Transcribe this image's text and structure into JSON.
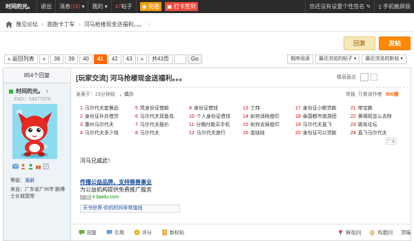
{
  "topbar": {
    "username": "时间的光。",
    "logout": "退出",
    "messages_label": "消息",
    "messages_count": "(16)",
    "mine_label": "我的",
    "coins_count": "47",
    "coins_label": "帖子",
    "recharge": "充值",
    "checkin": "打卡签到",
    "signature_prompt": "您还没有设置个性签名",
    "mobile": "手机触屏版"
  },
  "breadcrumb": {
    "items": [
      "豫见论坛",
      "跑跑卡丁车",
      "河马抢楼现金送福利。。。"
    ]
  },
  "actions_top": {
    "reply": "回复",
    "post": "发帖"
  },
  "pager": {
    "back": "« 返回列表",
    "first": "«",
    "pages": [
      "38",
      "39",
      "40",
      "41",
      "42",
      "43"
    ],
    "current": "41",
    "next": "»",
    "total": "共43页",
    "go": "Go"
  },
  "sortbar": {
    "items": [
      "倒序阅读",
      "最近浏览的帖子 ▾",
      "最近浏览的新帖 ▾"
    ]
  },
  "sidebar": {
    "reply_count": "854个回复",
    "username": "时间的光。",
    "uid": "ZxID：53477079",
    "level_label": "等级：",
    "level_value": "准尉",
    "from_label": "来自：广东省广州市 鹏博士长城宽带"
  },
  "post": {
    "tag": "[玩家交流]",
    "title": "河马抢楼现金送福利。。。",
    "subscribe_label": "楼层直达",
    "posted_time": "发表于：23分钟前",
    "author_link": "，偶尔",
    "report": "举报",
    "only_author": "只看该作者",
    "floor": "800楼",
    "content": "河马兄威武！",
    "banner_ad": {
      "line1": "传播公益品牌，支持慈善事业",
      "line2": "为公益机构提供免费推广服务",
      "domain_tag": "广告",
      "domain": "e.baidu.com"
    },
    "signature": "天书世界-你的时间非常值钱"
  },
  "ad_columns": [
    [
      {
        "n": "1",
        "t": "马尔代夫套餐品"
      },
      {
        "n": "2",
        "t": "身份证补办借贷"
      },
      {
        "n": "3",
        "t": "惠州马尔代夫"
      },
      {
        "n": "4",
        "t": "马尔代夫多少钱"
      }
    ],
    [
      {
        "n": "5",
        "t": "凭身份证借款"
      },
      {
        "n": "6",
        "t": "马尔代夫双鱼岛"
      },
      {
        "n": "7",
        "t": "马尔代夫报价"
      },
      {
        "n": "8",
        "t": "马尔代夫"
      }
    ],
    [
      {
        "n": "9",
        "t": "身份证借钱"
      },
      {
        "n": "10",
        "t": "个人身份证借钱"
      },
      {
        "n": "11",
        "t": "分期付款买手机"
      },
      {
        "n": "12",
        "t": "马尔代夫旅行"
      }
    ],
    [
      {
        "n": "13",
        "t": "丁炜"
      },
      {
        "n": "14",
        "t": "如何消除痘印"
      },
      {
        "n": "15",
        "t": "如何去掉痘印"
      },
      {
        "n": "16",
        "t": "金娃娃"
      }
    ],
    [
      {
        "n": "17",
        "t": "身份证小额贷款"
      },
      {
        "n": "18",
        "t": "泰国都市旅游团"
      },
      {
        "n": "19",
        "t": "马尔代夫直飞"
      },
      {
        "n": "20",
        "t": "身份证可以贷款"
      }
    ],
    [
      {
        "n": "21",
        "t": "常宝鹏"
      },
      {
        "n": "22",
        "t": "黄褐斑怎么去除"
      },
      {
        "n": "23",
        "t": "跳岛论坛"
      },
      {
        "n": "24",
        "t": "直飞马尔代夫"
      }
    ]
  ],
  "ad_tag": "广告",
  "bottom_actions": {
    "reply": "回复",
    "quote": "引用",
    "rate": "评分",
    "report": "新标帖",
    "flower": "鲜花[0]",
    "egg": "鸡蛋[0]",
    "top": "顶端"
  }
}
